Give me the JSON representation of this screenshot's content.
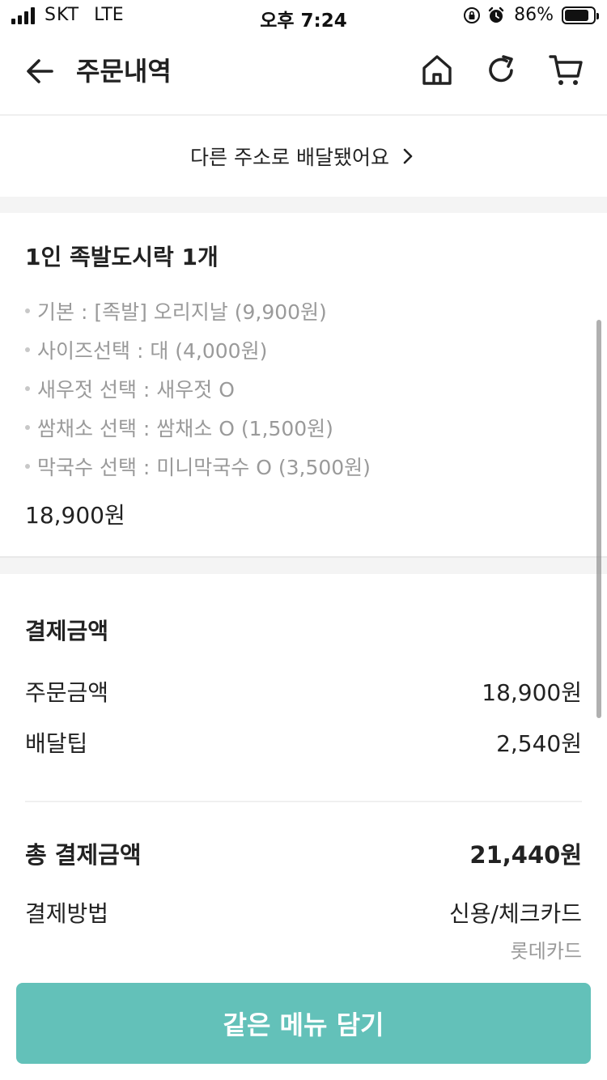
{
  "status_bar": {
    "carrier": "SKT",
    "network": "LTE",
    "time": "오후 7:24",
    "battery": "86%",
    "battery_level": 0.86,
    "icons": [
      "signal-icon",
      "orientation-lock-icon",
      "alarm-icon",
      "battery-icon"
    ]
  },
  "header": {
    "title": "주문내역",
    "icons": [
      "back-arrow-icon",
      "home-icon",
      "refresh-icon",
      "cart-icon"
    ]
  },
  "address": {
    "text": "다른 주소로 배달됐어요",
    "icon": "chevron-right-icon"
  },
  "order_item": {
    "title": "1인 족발도시락 1개",
    "options": [
      "기본 : [족발] 오리지날 (9,900원)",
      "사이즈선택 : 대 (4,000원)",
      "새우젓 선택 : 새우젓 O",
      "쌈채소 선택 : 쌈채소 O (1,500원)",
      "막국수 선택 : 미니막국수 O (3,500원)"
    ],
    "price": "18,900원"
  },
  "payment": {
    "title": "결제금액",
    "order_amount": {
      "label": "주문금액",
      "value": "18,900원"
    },
    "delivery_tip": {
      "label": "배달팁",
      "value": "2,540원"
    },
    "total": {
      "label": "총 결제금액",
      "value": "21,440원"
    },
    "method": {
      "label": "결제방법",
      "value": "신용/체크카드",
      "card": "롯데카드"
    }
  },
  "cta": {
    "label": "같은 메뉴 담기"
  },
  "colors": {
    "accent": "#63c1b9",
    "muted_text": "#9a9a9a",
    "band": "#f4f4f4"
  }
}
